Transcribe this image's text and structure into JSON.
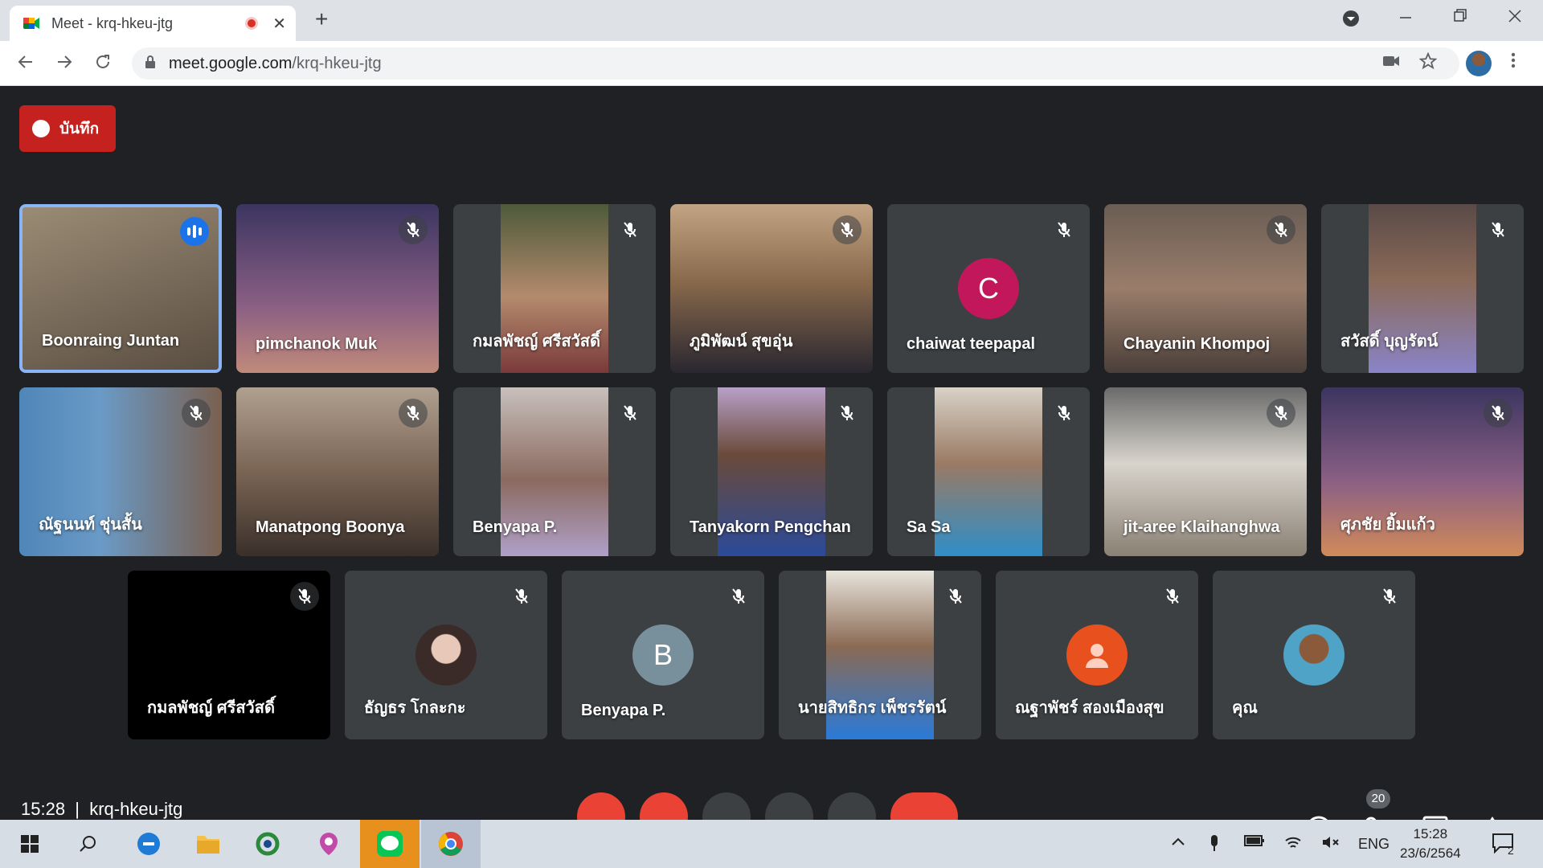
{
  "browser": {
    "tab_title": "Meet - krq-hkeu-jtg",
    "tab_close": "✕",
    "new_tab": "+",
    "url_domain": "meet.google.com",
    "url_path": "/krq-hkeu-jtg"
  },
  "meet": {
    "record_label": "บันทึก",
    "time": "15:28",
    "meeting_code": "krq-hkeu-jtg",
    "participants_count": "20",
    "row1": [
      {
        "name": "Boonraing Juntan",
        "speaking": true,
        "bg": "#8d7a63"
      },
      {
        "name": "pimchanok Muk",
        "bg": "#5b4a7a"
      },
      {
        "name": "กมลพัชญ์ ศรีสวัสดิ์",
        "bg": "#6b6152"
      },
      {
        "name": "ภูมิพัฒน์ สุขอุ่น",
        "bg": "#a08668"
      },
      {
        "name": "chaiwat teepapal",
        "initial": "C",
        "avatar_color": "#c2185b"
      },
      {
        "name": "Chayanin Khompoj",
        "bg": "#7d6a5c"
      },
      {
        "name": "สวัสดิ์ บุญรัตน์",
        "bg": "#6a5a58"
      }
    ],
    "row2": [
      {
        "name": "ณัฐนนท์ ชุ่นสั้น",
        "bg": "#4f86b8"
      },
      {
        "name": "Manatpong Boonya",
        "bg": "#8a7868"
      },
      {
        "name": "Benyapa P.",
        "bg": "#9a8a8a"
      },
      {
        "name": "Tanyakorn Pengchan",
        "bg": "#8c6f8e"
      },
      {
        "name": "Sa Sa",
        "bg": "#b9b0a4"
      },
      {
        "name": "jit-aree Klaihanghwa",
        "bg": "#8f8a80"
      },
      {
        "name": "ศุภชัย ยิ้มแก้ว",
        "bg": "#5a4a78"
      }
    ],
    "row3": [
      {
        "name": "กมลพัชญ์ ศรีสวัสดิ์",
        "black": true
      },
      {
        "name": "ธัญธร โกละกะ",
        "avatar_color": "#d9c0b4"
      },
      {
        "name": "Benyapa P.",
        "initial": "B",
        "avatar_color": "#78909c"
      },
      {
        "name": "นายสิทธิกร เพ็ชรรัตน์",
        "bg": "#6e7f96"
      },
      {
        "name": "ณฐาพัชร์ สองเมืองสุข",
        "avatar_color": "#e8501e",
        "person_icon": true
      },
      {
        "name": "คุณ",
        "avatar_color": "#4fa3c7"
      }
    ]
  },
  "taskbar": {
    "lang": "ENG",
    "clock_time": "15:28",
    "clock_date": "23/6/2564",
    "notif_count": "2"
  }
}
